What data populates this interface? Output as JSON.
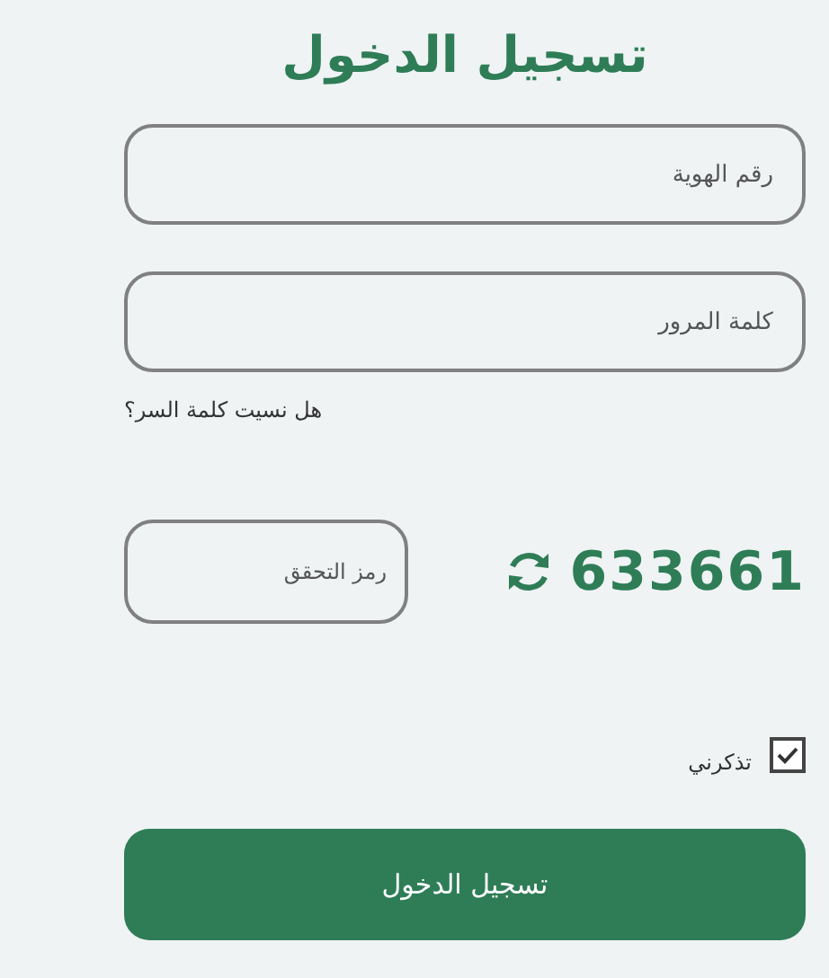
{
  "title": "تسجيل الدخول",
  "fields": [
    {
      "placeholder": "رقم الهوية"
    },
    {
      "placeholder": "كلمة المرور"
    }
  ],
  "forgot_link": "هل نسيت كلمة السر؟",
  "captcha": {
    "code": "633661",
    "placeholder": "رمز التحقق"
  },
  "remember": {
    "label": "تذكرني",
    "checked": true
  },
  "submit": "تسجيل الدخول"
}
